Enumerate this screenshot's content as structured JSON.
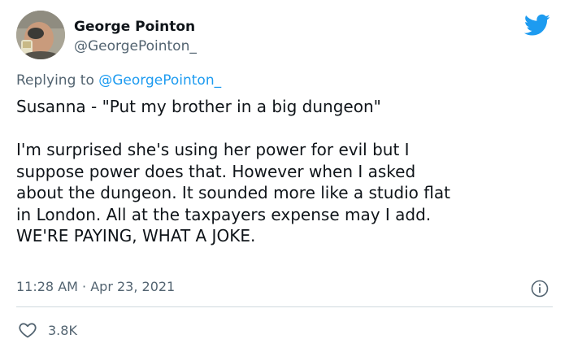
{
  "author": {
    "display_name": "George Pointon",
    "handle": "@GeorgePointon_"
  },
  "reply": {
    "prefix": "Replying to ",
    "handle": "@GeorgePointon_"
  },
  "tweet": {
    "text": "Susanna - \"Put my brother in a big dungeon\"\n\nI'm surprised she's using her power for evil but I\nsuppose power does that. However when I asked\nabout the dungeon. It sounded more like a studio flat\nin London. All at the taxpayers expense may I add.\nWE'RE PAYING, WHAT A JOKE."
  },
  "meta": {
    "time": "11:28 AM",
    "separator": " · ",
    "date": "Apr 23, 2021"
  },
  "engagement": {
    "likes": "3.8K"
  },
  "icons": {
    "brand": "twitter-bird-icon",
    "info": "info-icon",
    "like": "heart-icon"
  },
  "colors": {
    "accent": "#1d9bf0",
    "secondary_text": "#536471",
    "divider": "#cfd9de"
  }
}
